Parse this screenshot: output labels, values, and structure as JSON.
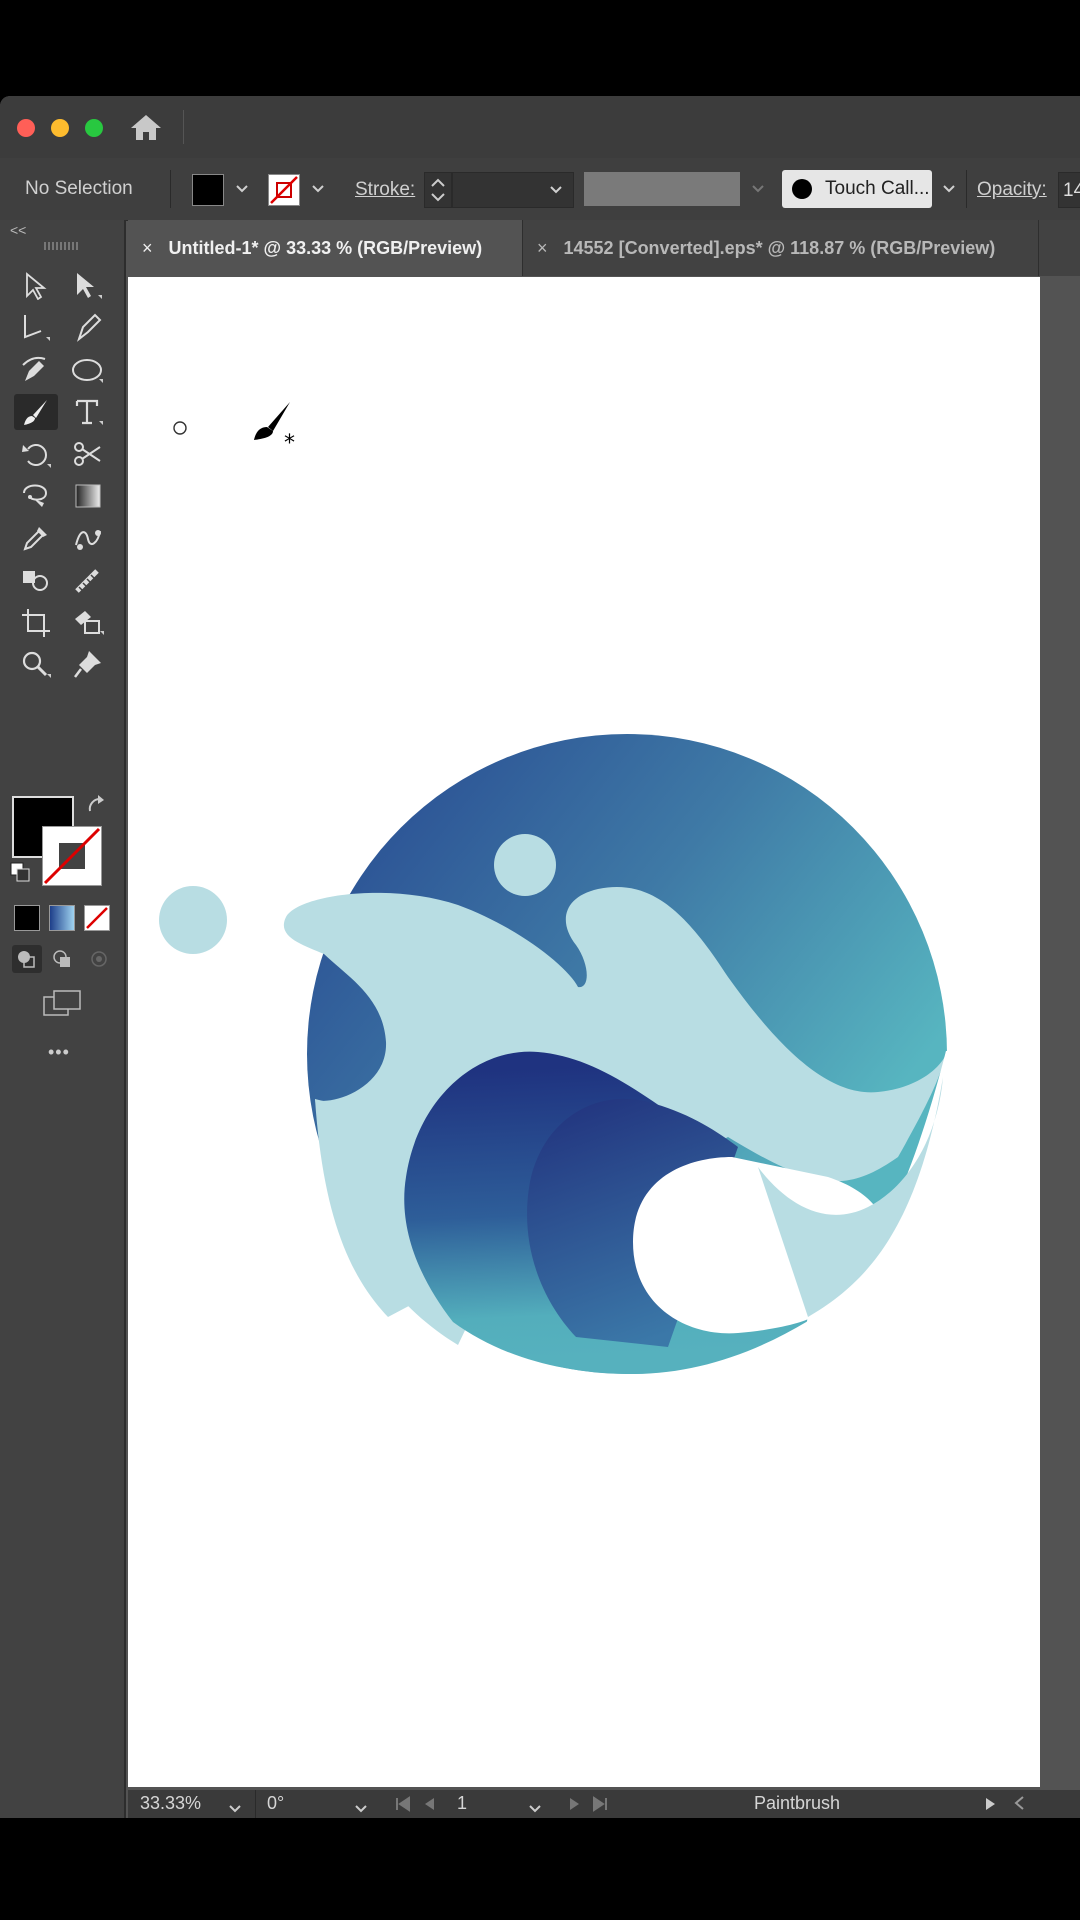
{
  "control_bar": {
    "selection_label": "No Selection",
    "stroke_label": "Stroke:",
    "brush_label": "Touch Call...",
    "opacity_label": "Opacity:",
    "opacity_value": "14"
  },
  "tabs": [
    {
      "label": "Untitled-1* @ 33.33 % (RGB/Preview)",
      "close": "×",
      "active": true
    },
    {
      "label": "14552 [Converted].eps* @ 118.87 % (RGB/Preview)",
      "close": "×",
      "active": false
    }
  ],
  "status_bar": {
    "zoom": "33.33%",
    "rotation": "0°",
    "artboard_number": "1",
    "current_tool": "Paintbrush"
  },
  "toolbar": {
    "collapse_glyph": "<<",
    "more_glyph": "•••"
  },
  "colors": {
    "fill": "#000000",
    "wave_dark": "#223a86",
    "wave_mid": "#3d78a3",
    "wave_light": "#55b3be",
    "foam": "#b9dfe4"
  }
}
